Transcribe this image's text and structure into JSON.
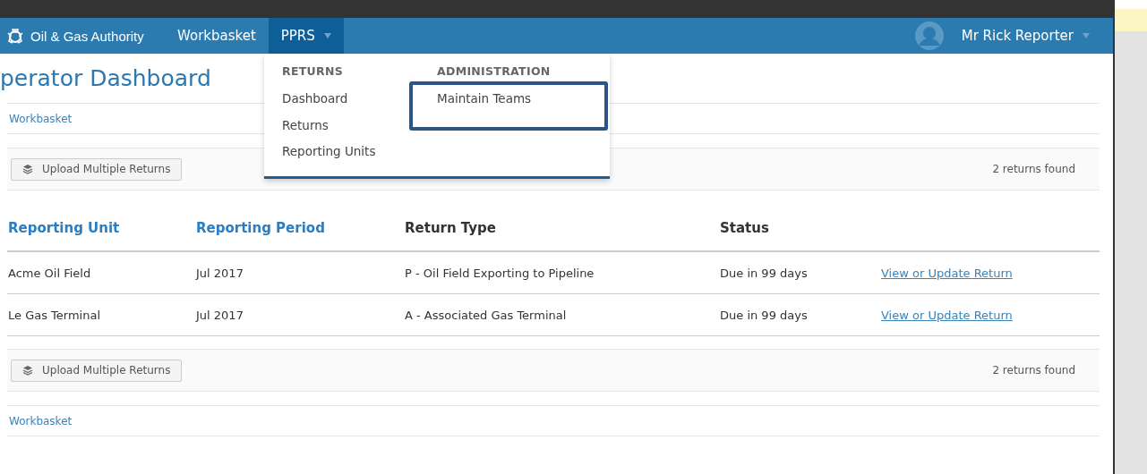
{
  "header": {
    "brand": "Oil & Gas Authority",
    "nav": [
      {
        "label": "Workbasket",
        "selected": false,
        "dropdown": false
      },
      {
        "label": "PPRS",
        "selected": true,
        "dropdown": true
      }
    ],
    "user": {
      "name": "Mr Rick Reporter"
    }
  },
  "menu": {
    "open": true,
    "sections": [
      {
        "heading": "RETURNS",
        "items": [
          {
            "label": "Dashboard",
            "highlighted": false
          },
          {
            "label": "Returns",
            "highlighted": false
          },
          {
            "label": "Reporting Units",
            "highlighted": false
          }
        ]
      },
      {
        "heading": "ADMINISTRATION",
        "items": [
          {
            "label": "Maintain Teams",
            "highlighted": true
          }
        ]
      }
    ]
  },
  "page": {
    "title": "perator Dashboard",
    "breadcrumb_top": "Workbasket",
    "toolbar_top": {
      "button": "Upload Multiple Returns",
      "count": "2 returns found"
    },
    "table": {
      "columns": [
        {
          "label": "Reporting Unit",
          "sortable": true
        },
        {
          "label": "Reporting Period",
          "sortable": true
        },
        {
          "label": "Return Type",
          "sortable": false
        },
        {
          "label": "Status",
          "sortable": false
        }
      ],
      "rows": [
        {
          "cells": [
            "Acme Oil Field",
            "Jul 2017",
            "P - Oil Field Exporting to Pipeline",
            "Due in 99 days"
          ],
          "link": "View or Update Return"
        },
        {
          "cells": [
            "Le Gas Terminal",
            "Jul 2017",
            "A - Associated Gas Terminal",
            "Due in 99 days"
          ],
          "link": "View or Update Return"
        }
      ]
    },
    "toolbar_bottom": {
      "button": "Upload Multiple Returns",
      "count": "2 returns found"
    },
    "breadcrumb_bottom": "Workbasket"
  }
}
